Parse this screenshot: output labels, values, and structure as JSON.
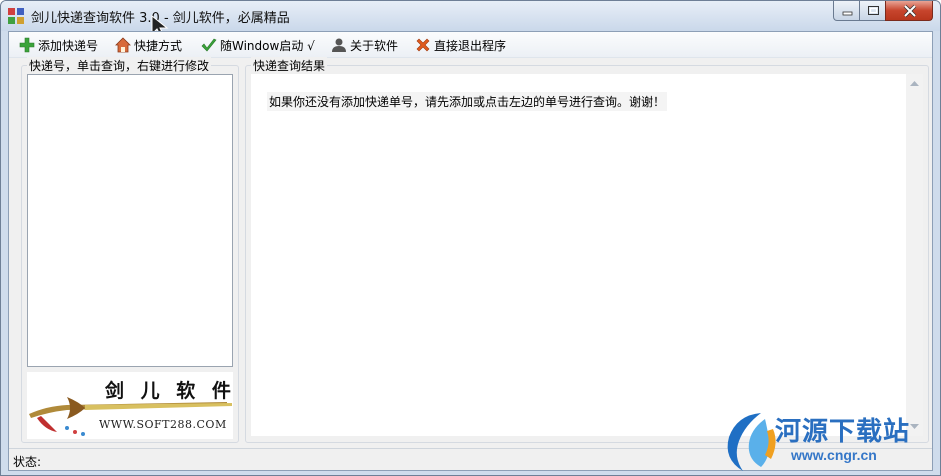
{
  "window": {
    "title": "剑儿快递查询软件 3.0 - 剑儿软件，必属精品"
  },
  "toolbar": {
    "items": [
      {
        "label": "添加快递号",
        "icon": "plus-icon",
        "color": "#3aa33a"
      },
      {
        "label": "快捷方式",
        "icon": "home-icon",
        "color": "#c8502a"
      },
      {
        "label": "随Window启动 √",
        "icon": "check-icon",
        "color": "#3aa33a"
      },
      {
        "label": "关于软件",
        "icon": "user-icon",
        "color": "#444444"
      },
      {
        "label": "直接退出程序",
        "icon": "x-icon",
        "color": "#e05a1e"
      }
    ]
  },
  "left_panel": {
    "label": "快递号，单击查询，右键进行修改",
    "logo_text_cn": "剑 儿 软 件",
    "logo_text_en": "WWW.SOFT288.COM"
  },
  "right_panel": {
    "label": "快递查询结果",
    "message": "如果你还没有添加快递单号，请先添加或点击左边的单号进行查询。谢谢！"
  },
  "status": {
    "label": "状态:"
  },
  "watermark": {
    "text": "河源下载站",
    "url": "www.cngr.cn"
  }
}
